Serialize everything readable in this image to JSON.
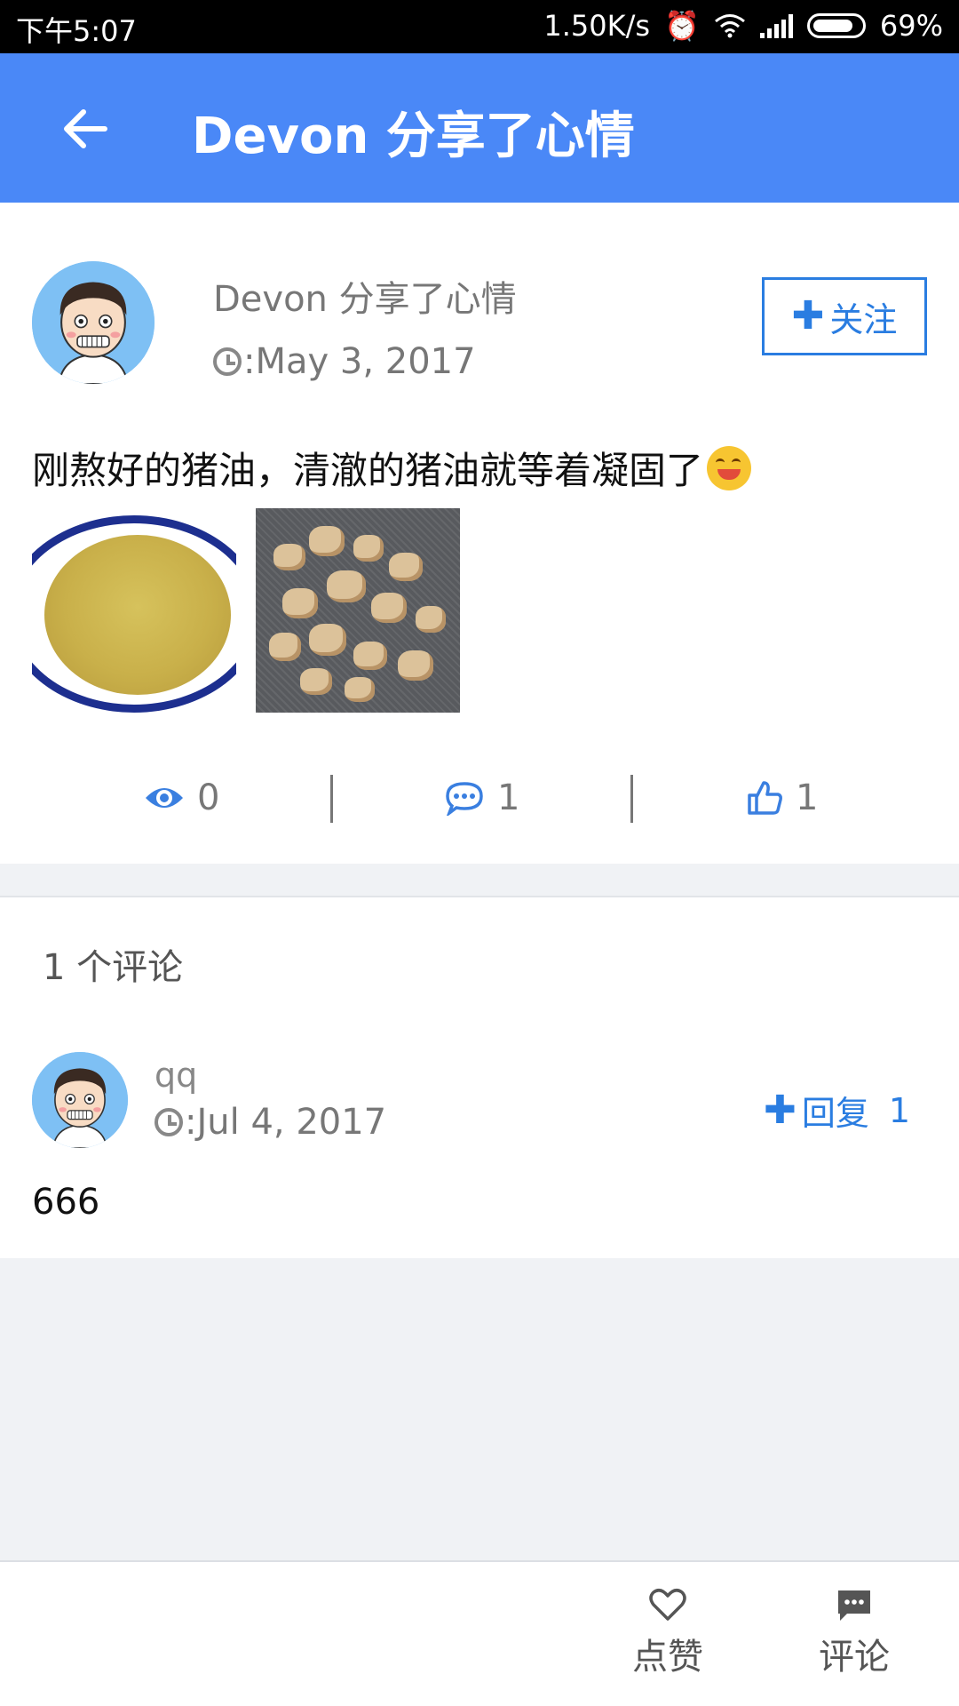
{
  "status_bar": {
    "time": "下午5:07",
    "net_speed": "1.50K/s",
    "battery": "69%"
  },
  "app_bar": {
    "title": "Devon 分享了心情"
  },
  "post": {
    "author_line": "Devon 分享了心情",
    "date": ":May 3, 2017",
    "follow_label": "关注",
    "text": "刚熬好的猪油，清澈的猪油就等着凝固了",
    "stats": {
      "views": "0",
      "comments": "1",
      "likes": "1"
    }
  },
  "comments": {
    "count_label": "1 个评论",
    "items": [
      {
        "user": "qq",
        "date": ":Jul 4, 2017",
        "reply_label": "回复",
        "reply_count": "1",
        "text": "666"
      }
    ]
  },
  "bottom_bar": {
    "like_label": "点赞",
    "comment_label": "评论"
  },
  "colors": {
    "primary": "#4a88f7",
    "accent": "#2a7de1"
  }
}
